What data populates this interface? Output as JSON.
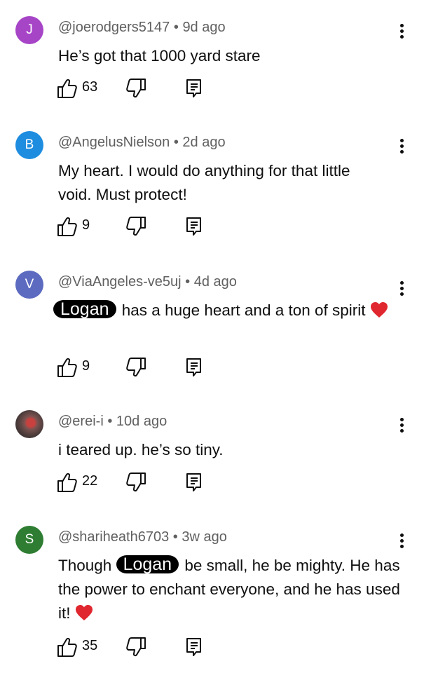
{
  "colors": {
    "avatar_j": "#a745c7",
    "avatar_b": "#1e8de0",
    "avatar_v": "#5c6bc0",
    "avatar_s": "#2e7d32",
    "heart": "#e0262e"
  },
  "comments": [
    {
      "avatar_letter": "J",
      "author": "@joerodgers5147",
      "separator": "•",
      "time": "9d ago",
      "text": "He’s got that 1000 yard stare",
      "likes": "63"
    },
    {
      "avatar_letter": "B",
      "author": "@AngelusNielson",
      "separator": "•",
      "time": "2d ago",
      "text": "My heart.  I would do anything for that little void.  Must protect!",
      "likes": "9"
    },
    {
      "avatar_letter": "V",
      "author": "@ViaAngeles-ve5uj",
      "separator": "•",
      "time": "4d ago",
      "redacted": "Logan",
      "text_after": " has a huge heart and a ton of spirit ",
      "likes": "9"
    },
    {
      "avatar_letter": "",
      "author": "@erei-i",
      "separator": "•",
      "time": "10d ago",
      "text": "i teared up. he’s so tiny.",
      "likes": "22"
    },
    {
      "avatar_letter": "S",
      "author": "@shariheath6703",
      "separator": "•",
      "time": "3w ago",
      "text_before": "Though ",
      "redacted": "Logan",
      "text_after": " be small, he be mighty.  He has the power to enchant everyone, and he has used it! ",
      "likes": "35"
    }
  ],
  "icons": {
    "like": "thumbs-up-icon",
    "dislike": "thumbs-down-icon",
    "reply": "reply-comment-icon",
    "menu": "more-vertical-icon",
    "heart": "red-heart-emoji"
  }
}
